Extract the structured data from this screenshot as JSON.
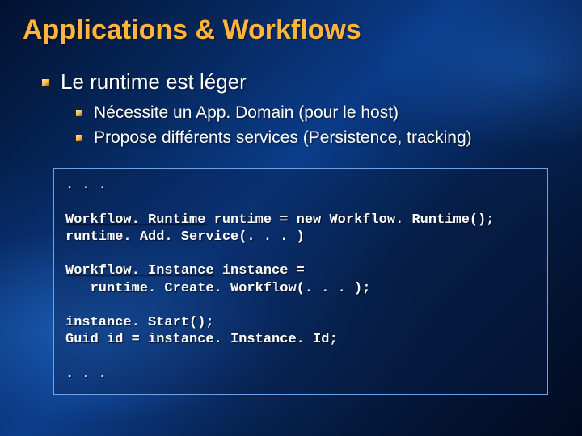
{
  "title": "Applications & Workflows",
  "bullets": {
    "l1": "Le runtime est léger",
    "l2a": "Nécessite un App. Domain (pour le host)",
    "l2b": "Propose différents services (Persistence, tracking)"
  },
  "code": {
    "dots_top": ". . .",
    "type1": "Workflow. Runtime",
    "line1_rest": " runtime = new Workflow. Runtime();",
    "line2": "runtime. Add. Service(. . . )",
    "type2": "Workflow. Instance",
    "line3_rest": " instance =",
    "line4": "   runtime. Create. Workflow(. . . );",
    "line5": "instance. Start();",
    "line6": "Guid id = instance. Instance. Id;",
    "dots_bottom": ". . ."
  }
}
